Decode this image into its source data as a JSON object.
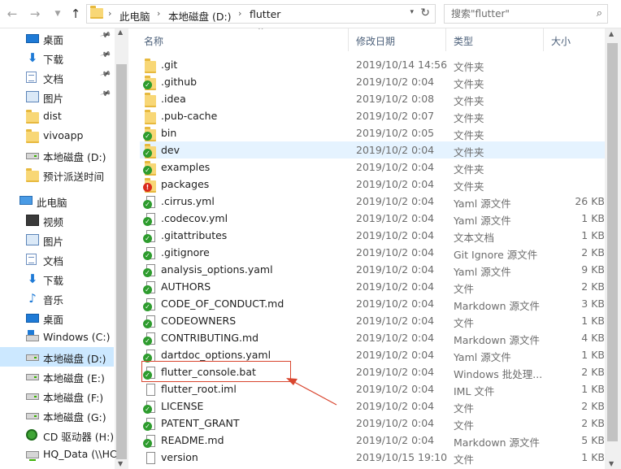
{
  "address_bar": {
    "breadcrumbs": [
      "此电脑",
      "本地磁盘 (D:)",
      "flutter"
    ],
    "search_placeholder": "搜索\"flutter\""
  },
  "sidebar": {
    "items": [
      {
        "label": "桌面",
        "icon": "desktop-icon",
        "pinned": true,
        "level": 1
      },
      {
        "label": "下载",
        "icon": "download-icon",
        "pinned": true,
        "level": 1
      },
      {
        "label": "文档",
        "icon": "document-icon",
        "pinned": true,
        "level": 1
      },
      {
        "label": "图片",
        "icon": "picture-icon",
        "pinned": true,
        "level": 1
      },
      {
        "label": "dist",
        "icon": "folder-icon",
        "pinned": false,
        "level": 1
      },
      {
        "label": "vivoapp",
        "icon": "folder-icon",
        "pinned": false,
        "level": 1
      },
      {
        "label": "本地磁盘 (D:)",
        "icon": "drive-icon",
        "pinned": false,
        "level": 1
      },
      {
        "label": "预计派送时间",
        "icon": "folder-icon",
        "pinned": false,
        "level": 1
      },
      {
        "label": "此电脑",
        "icon": "computer-icon",
        "pinned": false,
        "level": 2
      },
      {
        "label": "视频",
        "icon": "video-icon",
        "pinned": false,
        "level": 1
      },
      {
        "label": "图片",
        "icon": "picture-icon",
        "pinned": false,
        "level": 1
      },
      {
        "label": "文档",
        "icon": "document-icon",
        "pinned": false,
        "level": 1
      },
      {
        "label": "下载",
        "icon": "download-icon",
        "pinned": false,
        "level": 1
      },
      {
        "label": "音乐",
        "icon": "music-icon",
        "pinned": false,
        "level": 1
      },
      {
        "label": "桌面",
        "icon": "desktop-icon",
        "pinned": false,
        "level": 1
      },
      {
        "label": "Windows (C:)",
        "icon": "windows-drive-icon",
        "pinned": false,
        "level": 1
      },
      {
        "label": "本地磁盘 (D:)",
        "icon": "drive-icon",
        "pinned": false,
        "level": 1,
        "selected": true
      },
      {
        "label": "本地磁盘 (E:)",
        "icon": "drive-icon",
        "pinned": false,
        "level": 1
      },
      {
        "label": "本地磁盘 (F:)",
        "icon": "drive-icon",
        "pinned": false,
        "level": 1
      },
      {
        "label": "本地磁盘 (G:)",
        "icon": "drive-icon",
        "pinned": false,
        "level": 1
      },
      {
        "label": "CD 驱动器 (H:)",
        "icon": "cd-drive-icon",
        "pinned": false,
        "level": 1
      },
      {
        "label": "HQ_Data (\\\\HC",
        "icon": "network-drive-icon",
        "pinned": false,
        "level": 1
      }
    ]
  },
  "columns": {
    "name": "名称",
    "date": "修改日期",
    "type": "类型",
    "size": "大小"
  },
  "files": [
    {
      "name": ".git",
      "date": "2019/10/14 14:56",
      "type": "文件夹",
      "size": "",
      "kind": "folder",
      "badge": ""
    },
    {
      "name": ".github",
      "date": "2019/10/2 0:04",
      "type": "文件夹",
      "size": "",
      "kind": "folder",
      "badge": "green"
    },
    {
      "name": ".idea",
      "date": "2019/10/2 0:08",
      "type": "文件夹",
      "size": "",
      "kind": "folder",
      "badge": ""
    },
    {
      "name": ".pub-cache",
      "date": "2019/10/2 0:07",
      "type": "文件夹",
      "size": "",
      "kind": "folder",
      "badge": ""
    },
    {
      "name": "bin",
      "date": "2019/10/2 0:05",
      "type": "文件夹",
      "size": "",
      "kind": "folder",
      "badge": "green"
    },
    {
      "name": "dev",
      "date": "2019/10/2 0:04",
      "type": "文件夹",
      "size": "",
      "kind": "folder",
      "badge": "green",
      "hover": true
    },
    {
      "name": "examples",
      "date": "2019/10/2 0:04",
      "type": "文件夹",
      "size": "",
      "kind": "folder",
      "badge": "green"
    },
    {
      "name": "packages",
      "date": "2019/10/2 0:04",
      "type": "文件夹",
      "size": "",
      "kind": "folder",
      "badge": "red"
    },
    {
      "name": ".cirrus.yml",
      "date": "2019/10/2 0:04",
      "type": "Yaml 源文件",
      "size": "26 KB",
      "kind": "file",
      "badge": "green"
    },
    {
      "name": ".codecov.yml",
      "date": "2019/10/2 0:04",
      "type": "Yaml 源文件",
      "size": "1 KB",
      "kind": "file",
      "badge": "green"
    },
    {
      "name": ".gitattributes",
      "date": "2019/10/2 0:04",
      "type": "文本文档",
      "size": "1 KB",
      "kind": "file",
      "badge": "green"
    },
    {
      "name": ".gitignore",
      "date": "2019/10/2 0:04",
      "type": "Git Ignore 源文件",
      "size": "2 KB",
      "kind": "file",
      "badge": "green"
    },
    {
      "name": "analysis_options.yaml",
      "date": "2019/10/2 0:04",
      "type": "Yaml 源文件",
      "size": "9 KB",
      "kind": "file",
      "badge": "green"
    },
    {
      "name": "AUTHORS",
      "date": "2019/10/2 0:04",
      "type": "文件",
      "size": "2 KB",
      "kind": "file",
      "badge": "green"
    },
    {
      "name": "CODE_OF_CONDUCT.md",
      "date": "2019/10/2 0:04",
      "type": "Markdown 源文件",
      "size": "3 KB",
      "kind": "file",
      "badge": "green"
    },
    {
      "name": "CODEOWNERS",
      "date": "2019/10/2 0:04",
      "type": "文件",
      "size": "1 KB",
      "kind": "file",
      "badge": "green"
    },
    {
      "name": "CONTRIBUTING.md",
      "date": "2019/10/2 0:04",
      "type": "Markdown 源文件",
      "size": "4 KB",
      "kind": "file",
      "badge": "green"
    },
    {
      "name": "dartdoc_options.yaml",
      "date": "2019/10/2 0:04",
      "type": "Yaml 源文件",
      "size": "1 KB",
      "kind": "file",
      "badge": "green"
    },
    {
      "name": "flutter_console.bat",
      "date": "2019/10/2 0:04",
      "type": "Windows 批处理...",
      "size": "2 KB",
      "kind": "file",
      "badge": "green"
    },
    {
      "name": "flutter_root.iml",
      "date": "2019/10/2 0:04",
      "type": "IML 文件",
      "size": "1 KB",
      "kind": "file",
      "badge": ""
    },
    {
      "name": "LICENSE",
      "date": "2019/10/2 0:04",
      "type": "文件",
      "size": "2 KB",
      "kind": "file",
      "badge": "green"
    },
    {
      "name": "PATENT_GRANT",
      "date": "2019/10/2 0:04",
      "type": "文件",
      "size": "2 KB",
      "kind": "file",
      "badge": "green"
    },
    {
      "name": "README.md",
      "date": "2019/10/2 0:04",
      "type": "Markdown 源文件",
      "size": "5 KB",
      "kind": "file",
      "badge": "green"
    },
    {
      "name": "version",
      "date": "2019/10/15 19:10",
      "type": "文件",
      "size": "1 KB",
      "kind": "file",
      "badge": ""
    }
  ],
  "colors": {
    "selection": "#cce8ff",
    "hover": "#e5f3ff",
    "annotation": "#d9462f",
    "badge_ok": "#2e9c2e",
    "badge_conflict": "#d92a1c"
  }
}
